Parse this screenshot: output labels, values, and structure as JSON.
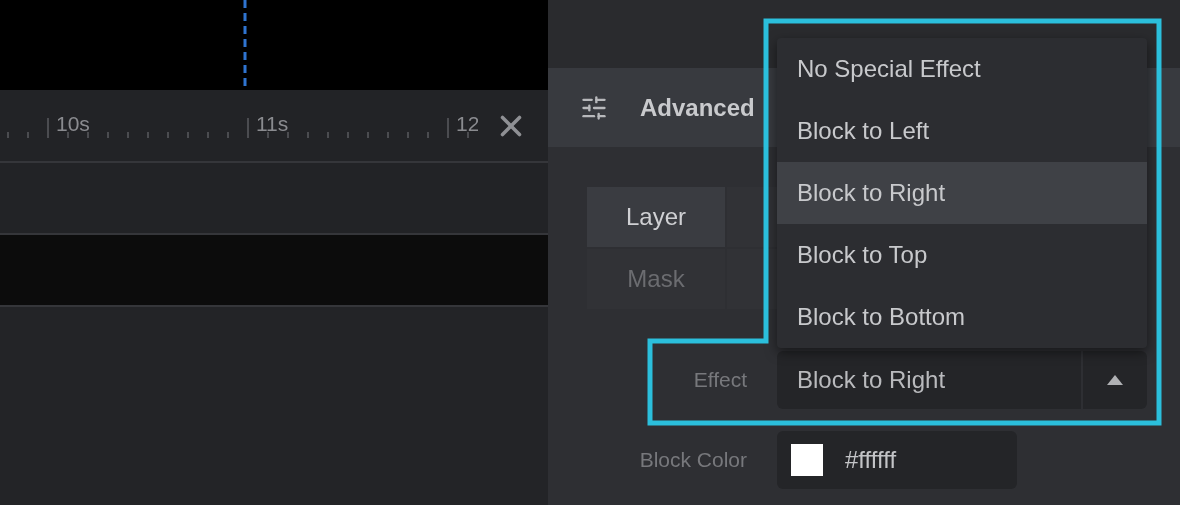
{
  "timeline": {
    "ruler_labels": [
      "10s",
      "11s",
      "12"
    ]
  },
  "panel": {
    "title": "Advanced",
    "tabs": [
      {
        "label": "Layer",
        "selected": true
      },
      {
        "label": "Mask",
        "selected": false
      }
    ],
    "effect": {
      "label": "Effect",
      "value": "Block to Right",
      "expanded": true,
      "options": [
        {
          "label": "No Special Effect",
          "selected": false
        },
        {
          "label": "Block to Left",
          "selected": false
        },
        {
          "label": "Block to Right",
          "selected": true
        },
        {
          "label": "Block to Top",
          "selected": false
        },
        {
          "label": "Block to Bottom",
          "selected": false
        }
      ]
    },
    "block_color": {
      "label": "Block Color",
      "value": "#ffffff",
      "color": "#ffffff"
    }
  }
}
